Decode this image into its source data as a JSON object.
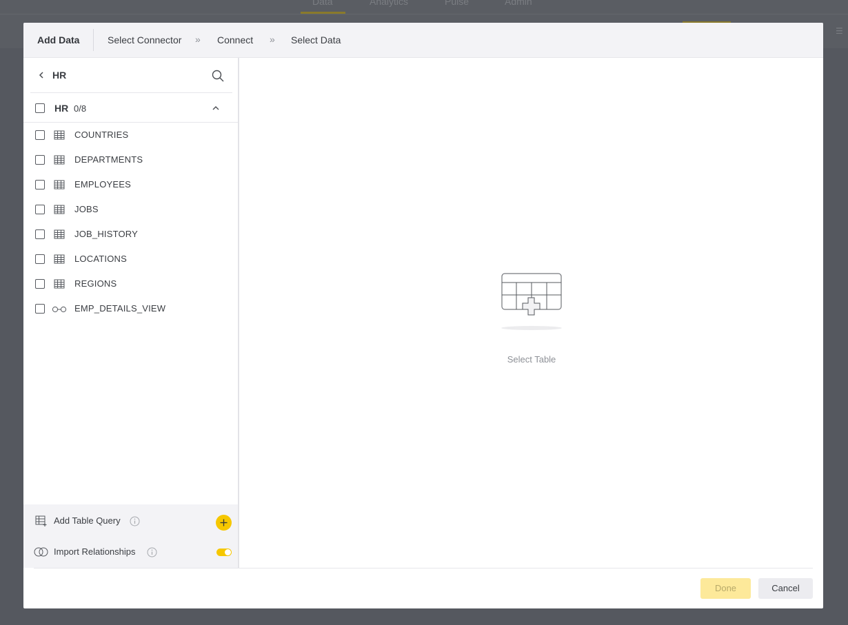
{
  "background_app": {
    "tabs": [
      "Data",
      "Analytics",
      "Pulse",
      "Admin"
    ]
  },
  "modal": {
    "title": "Add Data",
    "breadcrumb": {
      "steps": [
        "Select Connector",
        "Connect",
        "Select Data"
      ],
      "separator": "»"
    }
  },
  "left_panel": {
    "back_title": "HR",
    "schema": {
      "name": "HR",
      "count": "0/8",
      "items": [
        {
          "label": "COUNTRIES",
          "icon": "table-icon"
        },
        {
          "label": "DEPARTMENTS",
          "icon": "table-icon"
        },
        {
          "label": "EMPLOYEES",
          "icon": "table-icon"
        },
        {
          "label": "JOBS",
          "icon": "table-icon"
        },
        {
          "label": "JOB_HISTORY",
          "icon": "table-icon"
        },
        {
          "label": "LOCATIONS",
          "icon": "table-icon"
        },
        {
          "label": "REGIONS",
          "icon": "table-icon"
        },
        {
          "label": "EMP_DETAILS_VIEW",
          "icon": "view-icon"
        }
      ]
    },
    "footer": {
      "add_table_query": "Add Table Query",
      "import_relationships": "Import Relationships",
      "import_relationships_enabled": true
    }
  },
  "main": {
    "empty_label": "Select Table"
  },
  "buttons": {
    "done": "Done",
    "cancel": "Cancel"
  },
  "colors": {
    "accent": "#f6c700",
    "done_disabled_bg": "#fde99a",
    "overlay": "#55585f"
  }
}
